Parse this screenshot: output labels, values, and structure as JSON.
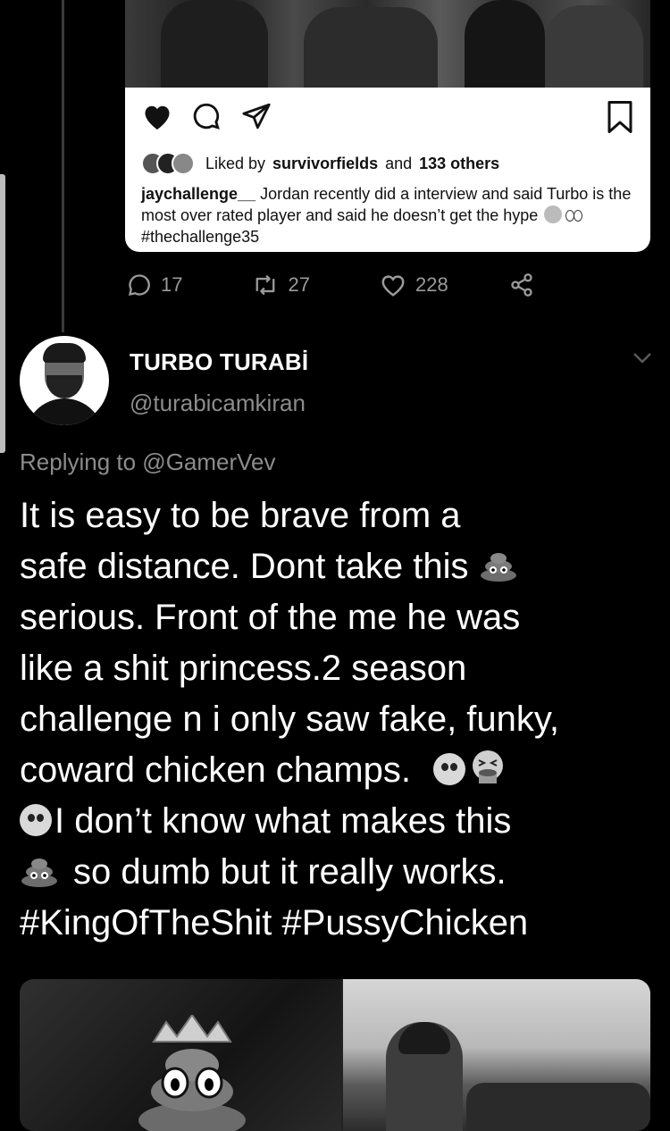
{
  "instagram_card": {
    "liked_prefix": "Liked by",
    "liked_user": "survivorfields",
    "liked_middle": "and",
    "liked_count": "133 others",
    "caption_user": "jaychallenge__",
    "caption_text": "Jordan recently did a interview and said Turbo is the most over rated player and said he doesn’t get the hype",
    "caption_hashtag": "#thechallenge35"
  },
  "quoted_stats": {
    "replies": "17",
    "retweets": "27",
    "likes": "228"
  },
  "tweet": {
    "display_name": "TURBO TURABİ",
    "handle": "@turabicamkiran",
    "replying_to": "Replying to @GamerVev",
    "line1": "It is easy to be brave from a",
    "line2": "safe distance. Dont take this",
    "line3": "serious. Front of the me he was",
    "line4": "like a shit princess.2 season",
    "line5": "challenge n i only saw fake, funky,",
    "line6": "coward chicken champs.",
    "line7": "I don’t know what makes this",
    "line8": "so dumb but it really works.",
    "line9": "#KingOfTheShit #PussyChicken"
  },
  "icons": [
    "heart-icon",
    "comment-icon",
    "share-icon",
    "bookmark-icon",
    "reply-icon",
    "retweet-icon",
    "like-icon",
    "share-network-icon",
    "chevron-down-icon",
    "pile-of-poo-emoji",
    "pleading-face-emoji",
    "vomiting-face-emoji"
  ],
  "colors": {
    "background": "#000000",
    "text": "#ffffff",
    "muted": "#8c8c8c",
    "card": "#ffffff"
  }
}
